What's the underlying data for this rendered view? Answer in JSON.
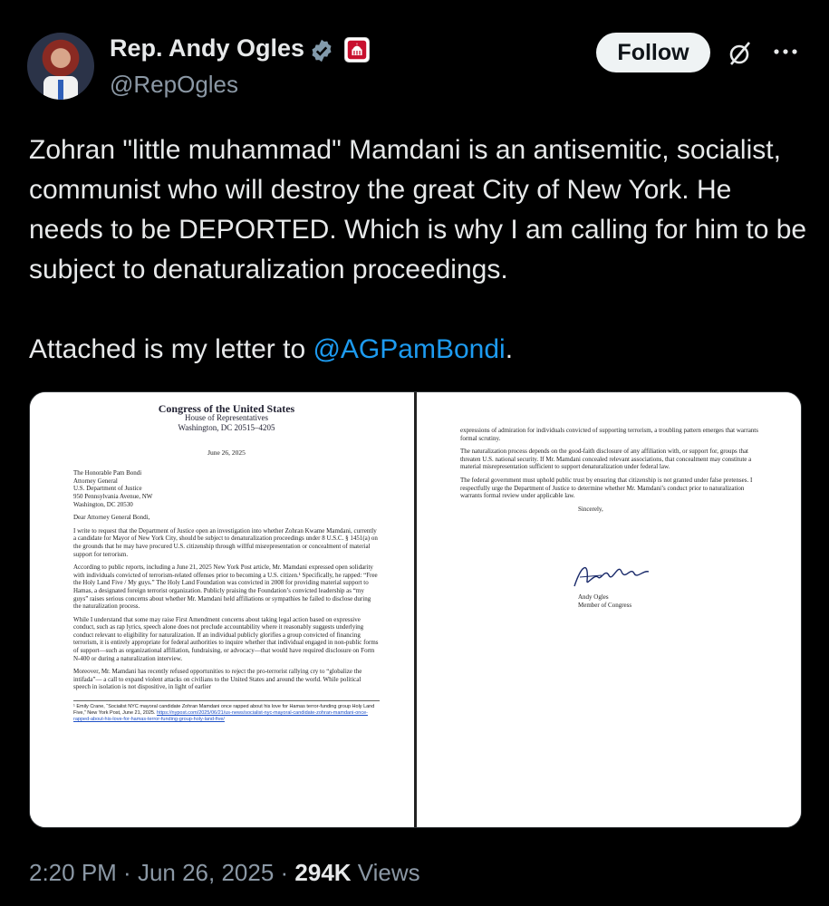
{
  "author": {
    "display_name": "Rep. Andy Ogles",
    "handle": "@RepOgles"
  },
  "actions": {
    "follow_label": "Follow"
  },
  "tweet": {
    "paragraph1": "Zohran \"little muhammad\" Mamdani is an antisemitic, socialist, communist who will destroy the great City of New York. He needs to be DEPORTED. Which is why I am calling for him to be subject to denaturalization proceedings.",
    "paragraph2_prefix": "Attached is my letter to ",
    "mention": "@AGPamBondi",
    "paragraph2_suffix": "."
  },
  "letter": {
    "page1": {
      "header1": "Congress of the United States",
      "header2": "House of Representatives",
      "header3": "Washington, DC 20515–4205",
      "date": "June 26, 2025",
      "address1": "The Honorable Pam Bondi",
      "address2": "Attorney General",
      "address3": "U.S. Department of Justice",
      "address4": "950 Pennsylvania Avenue, NW",
      "address5": "Washington, DC 20530",
      "salutation": "Dear Attorney General Bondi,",
      "para1": "I write to request that the Department of Justice open an investigation into whether Zohran Kwame Mamdani, currently a candidate for Mayor of New York City, should be subject to denaturalization proceedings under 8 U.S.C. § 1451(a) on the grounds that he may have procured U.S. citizenship through willful misrepresentation or concealment of material support for terrorism.",
      "para2": "According to public reports, including a June 21, 2025 New York Post article, Mr. Mamdani expressed open solidarity with individuals convicted of terrorism-related offenses prior to becoming a U.S. citizen.¹ Specifically, he rapped: “Free the Holy Land Five / My guys.” The Holy Land Foundation was convicted in 2008 for providing material support to Hamas, a designated foreign terrorist organization. Publicly praising the Foundation’s convicted leadership as “my guys” raises serious concerns about whether Mr. Mamdani held affiliations or sympathies he failed to disclose during the naturalization process.",
      "para3": "While I understand that some may raise First Amendment concerns about taking legal action based on expressive conduct, such as rap lyrics, speech alone does not preclude accountability where it reasonably suggests underlying conduct relevant to eligibility for naturalization. If an individual publicly glorifies a group convicted of financing terrorism, it is entirely appropriate for federal authorities to inquire whether that individual engaged in non-public forms of support—such as organizational affiliation, fundraising, or advocacy—that would have required disclosure on Form N-400 or during a naturalization interview.",
      "para4": "Moreover, Mr. Mamdani has recently refused opportunities to reject the pro-terrorist rallying cry to “globalize the intifada”— a call to expand violent attacks on civilians to the United States and around the world. While political speech in isolation is not dispositive, in light of earlier",
      "footnote": "¹ Emily Crane, “Socialist NYC mayoral candidate Zohran Mamdani once rapped about his love for Hamas terror-funding group Holy Land Five,” New York Post, June 21, 2025. ",
      "footnote_link": "https://nypost.com/2025/06/21/us-news/socialist-nyc-mayoral-candidate-zohran-mamdani-once-rapped-about-his-love-for-hamas-terror-funding-group-holy-land-five/"
    },
    "page2": {
      "para1": "expressions of admiration for individuals convicted of supporting terrorism, a troubling pattern emerges that warrants formal scrutiny.",
      "para2": "The naturalization process depends on the good-faith disclosure of any affiliation with, or support for, groups that threaten U.S. national security. If Mr. Mamdani concealed relevant associations, that concealment may constitute a material misrepresentation sufficient to support denaturalization under federal law.",
      "para3": "The federal government must uphold public trust by ensuring that citizenship is not granted under false pretenses. I respectfully urge the Department of Justice to determine whether Mr. Mamdani’s conduct prior to naturalization warrants formal review under applicable law.",
      "closing": "Sincerely,",
      "signer": "Andy Ogles",
      "signer_title": "Member of Congress"
    }
  },
  "meta": {
    "time": "2:20 PM",
    "sep1": " · ",
    "date": "Jun 26, 2025",
    "sep2": " · ",
    "views_count": "294K",
    "views_label": " Views"
  }
}
